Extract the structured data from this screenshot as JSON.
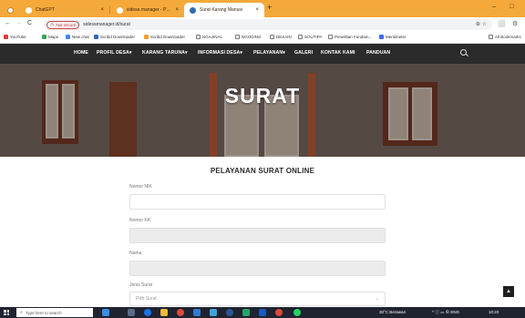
{
  "browser": {
    "tabs": [
      {
        "label": "ChatGPT",
        "fav_color": "#ffffff"
      },
      {
        "label": "sidesa manager - Pencarian",
        "fav_color": "#ffffff"
      },
      {
        "label": "Surat Karang Manusi",
        "fav_color": "#2d6ab8"
      }
    ],
    "close_glyph": "×",
    "new_tab": "+",
    "window_controls": [
      "–",
      "□"
    ],
    "nav": {
      "back": "←",
      "forward": "→",
      "reload": "C"
    },
    "security_label": "Not secure",
    "url": "sidesamanager.id/surat",
    "omni_icons": "⊕ ☆",
    "toolbar_icons": [
      "⬜",
      "⚙"
    ]
  },
  "bookmarks": [
    {
      "label": "YouTube",
      "color": "#e53935"
    },
    {
      "label": "Maps",
      "color": "#34a853"
    },
    {
      "label": "New chat",
      "color": "#4285f4"
    },
    {
      "label": "Scribd Downloader",
      "color": "#2d6ab8"
    },
    {
      "label": "Scribd Downloader",
      "color": "#f0a030"
    },
    {
      "label": "NGAJINAL",
      "color": "#777777"
    },
    {
      "label": "NGODING",
      "color": "#777777"
    },
    {
      "label": "DESAIN",
      "color": "#777777"
    },
    {
      "label": "SOUTIPA",
      "color": "#777777"
    },
    {
      "label": "Penelitian Fundam...",
      "color": "#777777"
    },
    {
      "label": "Mentimeter",
      "color": "#3c6cf0"
    },
    {
      "label": "All Bookmarks",
      "color": "#777777"
    }
  ],
  "site_nav": [
    "HOME",
    "PROFIL DESA▾",
    "KARANG TARUNA▾",
    "INFORMASI DESA▾",
    "PELAYANAN▾",
    "GALERI",
    "KONTAK KAMI",
    "PANDUAN"
  ],
  "hero": {
    "title": "SURAT"
  },
  "form": {
    "title": "PELAYANAN SURAT ONLINE",
    "fields": [
      {
        "label": "Nomor NIK",
        "value": "",
        "disabled": false
      },
      {
        "label": "Nomor KK",
        "value": "",
        "disabled": true
      },
      {
        "label": "Nama",
        "value": "",
        "disabled": true
      },
      {
        "label": "Jenis Surat",
        "value": "Pilih Surat",
        "disabled": false
      }
    ],
    "select_chevron": "⌄"
  },
  "scroll_top_glyph": "▲",
  "taskbar": {
    "search_placeholder": "Type here to search",
    "search_glyph": "⌕",
    "weather": "30°C Berawan",
    "tray": "^ ⓘ ▭ ⊕ ENG",
    "clock": "10:23"
  }
}
